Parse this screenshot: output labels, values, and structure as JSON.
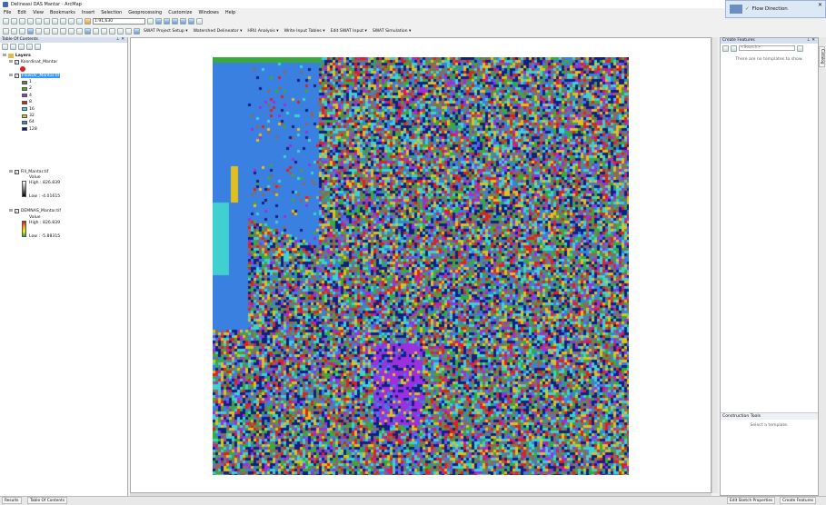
{
  "window": {
    "title": "Delineasi DAS Mantar - ArcMap"
  },
  "notification": {
    "text": "Flow Direction"
  },
  "menu": [
    "File",
    "Edit",
    "View",
    "Bookmarks",
    "Insert",
    "Selection",
    "Geoprocessing",
    "Customize",
    "Windows",
    "Help"
  ],
  "toolbar": {
    "scale_value": "1:91,630",
    "swat_menus": [
      "SWAT Project Setup ▾",
      "Watershed Delineator ▾",
      "HRU Analysis ▾",
      "Write Input Tables ▾",
      "Edit SWAT Input ▾",
      "SWAT Simulation ▾"
    ]
  },
  "toc": {
    "title": "Table Of Contents",
    "root": "Layers",
    "layers": [
      {
        "name": "Koordinat_Mantar"
      },
      {
        "name": "FlowDir_Mantar.tif",
        "selected": true
      },
      {
        "name": "Fill_Mantar.tif",
        "value_label": "Value",
        "high": "High : 826.839",
        "low": "Low : -4.01615"
      },
      {
        "name": "DEMNAS_Mantar.tif",
        "value_label": "Value",
        "high": "High : 826.839",
        "low": "Low : -5.88315"
      }
    ],
    "flowdir_classes": [
      {
        "label": "1",
        "color": "#8a6a5a"
      },
      {
        "label": "2",
        "color": "#3aaa3a"
      },
      {
        "label": "4",
        "color": "#9a30e0"
      },
      {
        "label": "8",
        "color": "#e02020"
      },
      {
        "label": "16",
        "color": "#40d0d0"
      },
      {
        "label": "32",
        "color": "#e0c020"
      },
      {
        "label": "64",
        "color": "#3a80e0"
      },
      {
        "label": "128",
        "color": "#102080"
      }
    ]
  },
  "create_features": {
    "title": "Create Features",
    "search_placeholder": "<Search>",
    "empty_text": "There are no templates to show.",
    "construction_title": "Construction Tools",
    "construction_hint": "Select a template.",
    "edit_sketch_label": "Edit Sketch Properties",
    "tab_label": "Create Features"
  },
  "bottom_tabs": {
    "results": "Results",
    "toc": "Table Of Contents"
  },
  "side_tab": "Catalog",
  "colors": {
    "selection": "#3399ff",
    "panel_header": "#d5dff0"
  }
}
